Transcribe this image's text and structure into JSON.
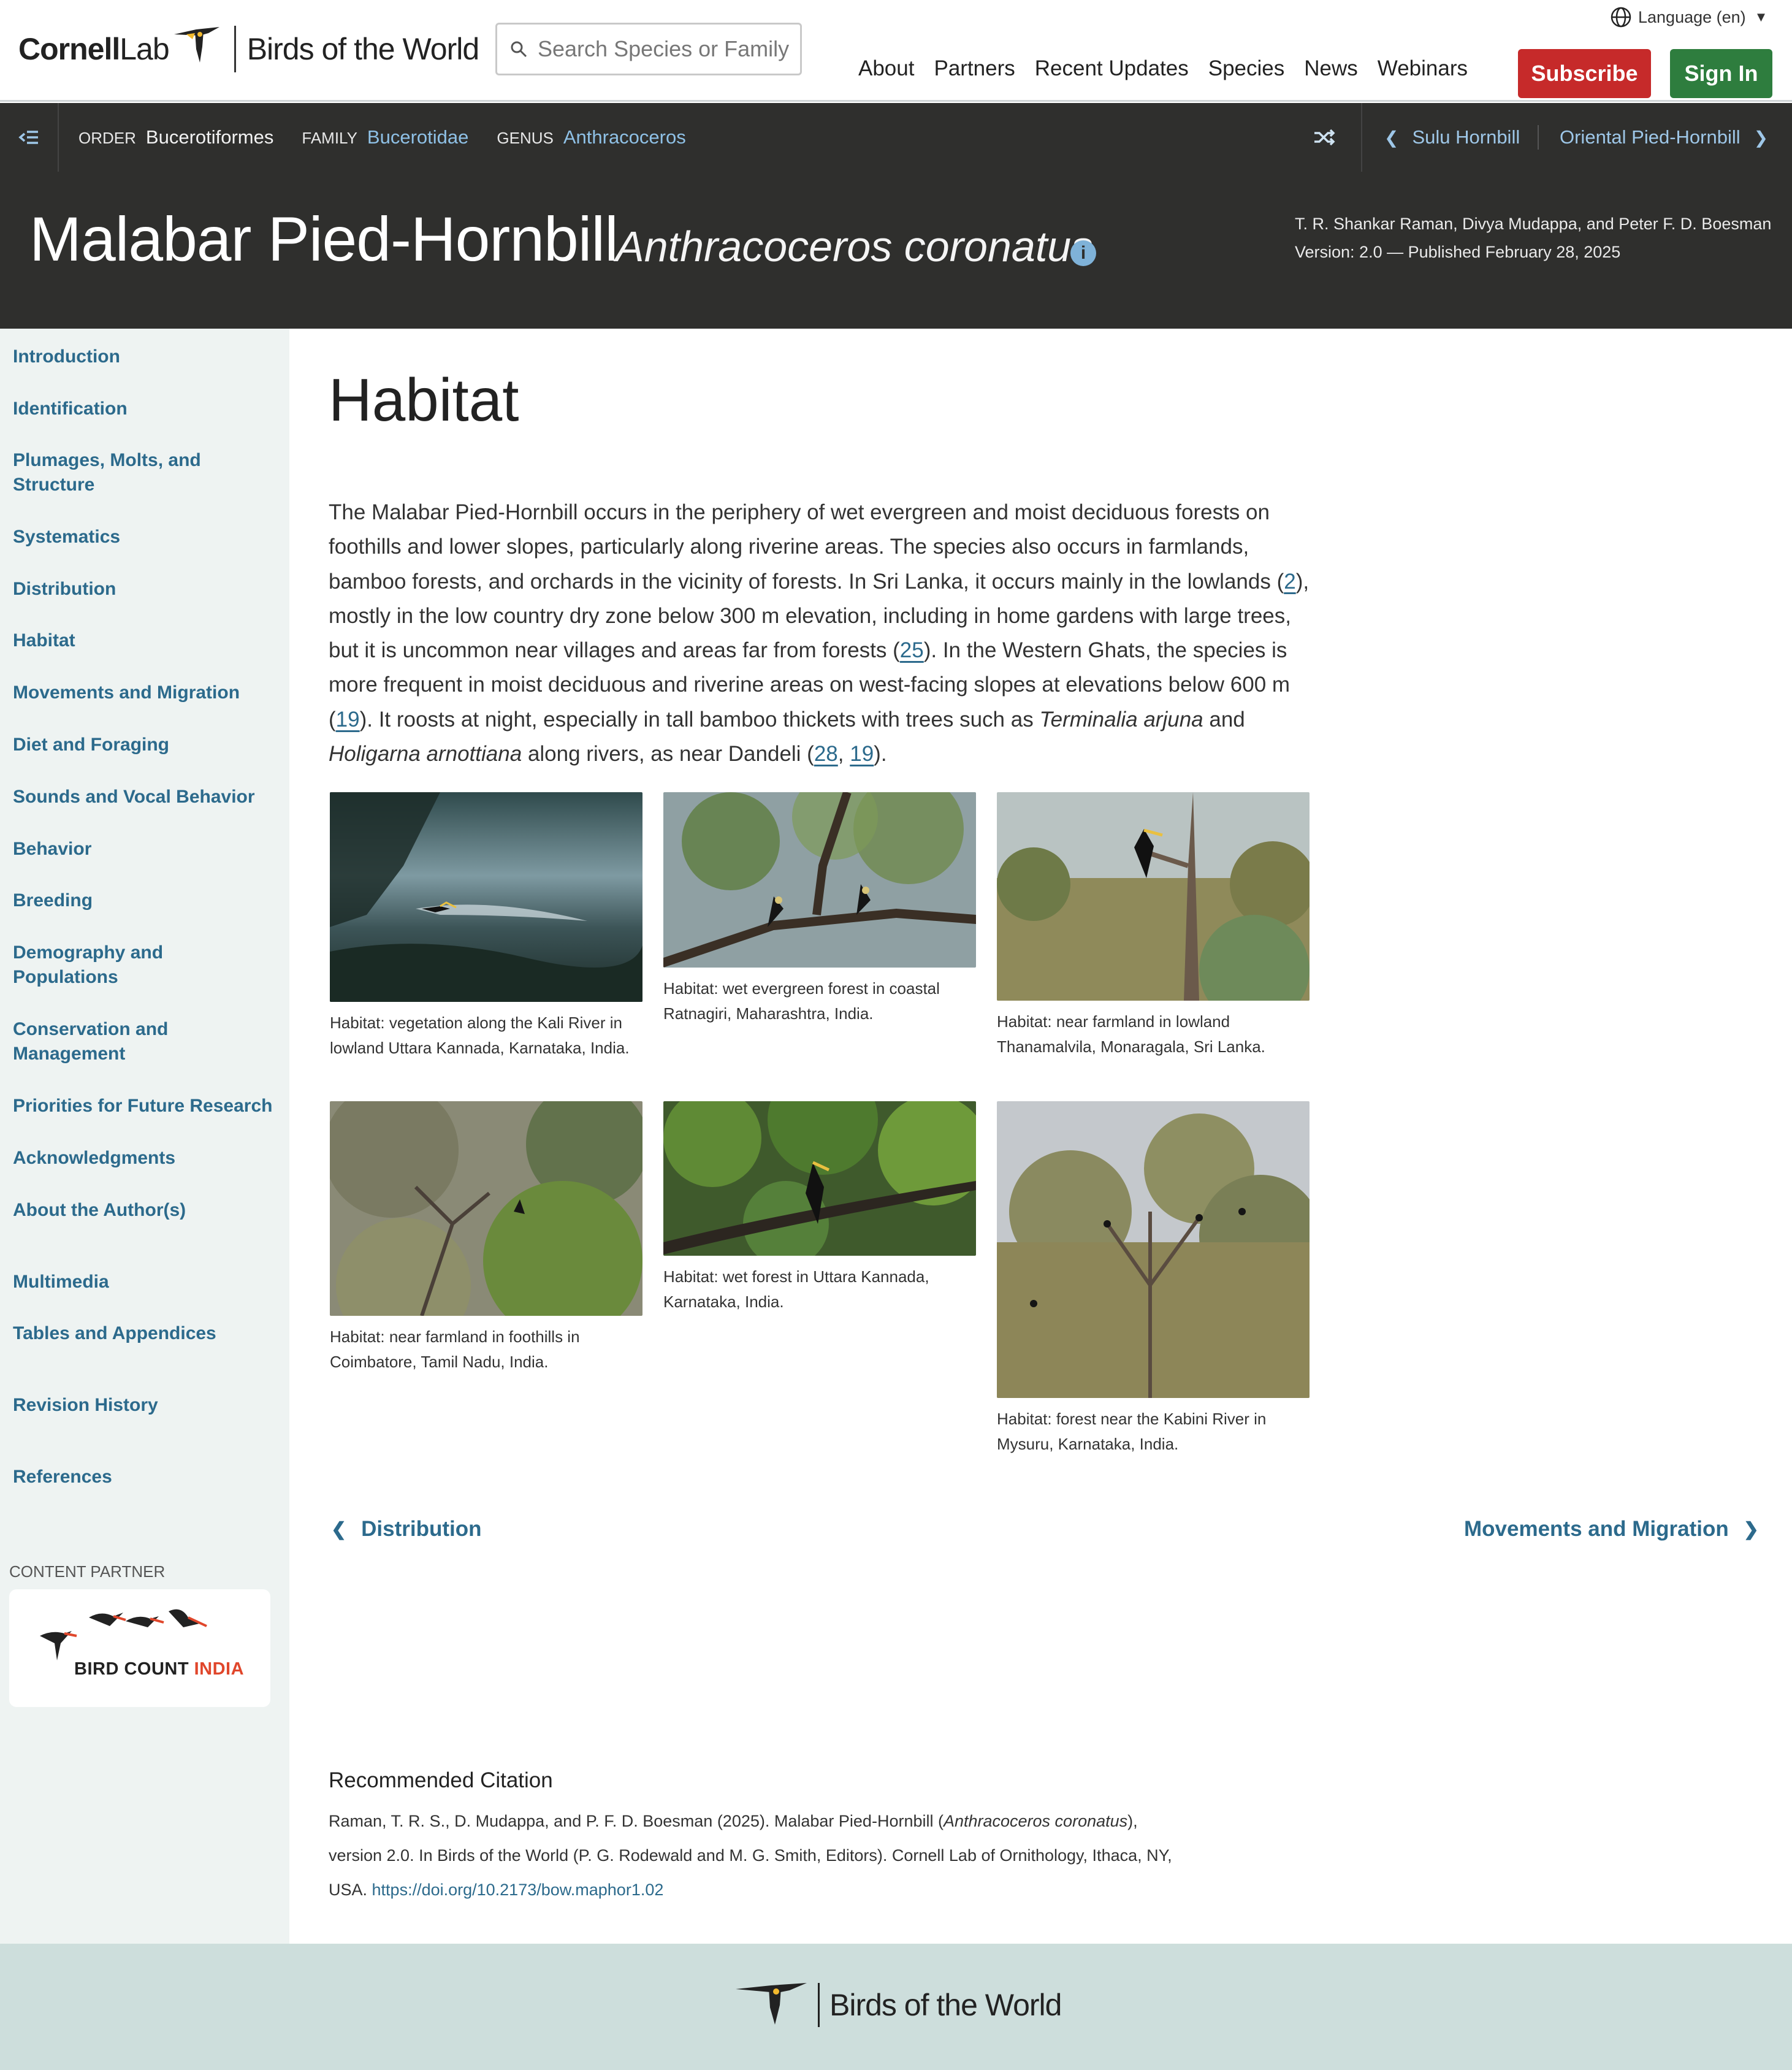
{
  "header": {
    "logo_lab": "CornellLab",
    "logo_lab_bold": "Cornell",
    "logo_lab_light": "Lab",
    "logo_title": "Birds of the World",
    "search_placeholder": "Search Species or Family",
    "language": "Language (en)",
    "nav": [
      "About",
      "Partners",
      "Recent Updates",
      "Species",
      "News",
      "Webinars"
    ],
    "subscribe": "Subscribe",
    "sign_in": "Sign In"
  },
  "taxonomy": {
    "order_label": "ORDER",
    "order": "Bucerotiformes",
    "family_label": "FAMILY",
    "family": "Bucerotidae",
    "genus_label": "GENUS",
    "genus": "Anthracoceros",
    "prev_species": "Sulu Hornbill",
    "next_species": "Oriental Pied-Hornbill"
  },
  "species": {
    "common_name": "Malabar Pied-Hornbill",
    "scientific_name": "Anthracoceros coronatus",
    "authors": "T. R. Shankar Raman, Divya Mudappa, and Peter F. D. Boesman",
    "version": "Version: 2.0 — Published February 28, 2025"
  },
  "sidebar": {
    "items": [
      "Introduction",
      "Identification",
      "Plumages, Molts, and",
      "Structure",
      "Systematics",
      "Distribution",
      "Habitat",
      "Movements and Migration",
      "Diet and Foraging",
      "Sounds and Vocal Behavior",
      "Behavior",
      "Breeding",
      "Demography and",
      "Populations",
      "Conservation and",
      "Management",
      "Priorities for Future Research",
      "Acknowledgments",
      "About the Author(s)",
      "Multimedia",
      "Tables and Appendices",
      "Revision History",
      "References"
    ],
    "content_partner_label": "CONTENT PARTNER",
    "partner_name_a": "BIRD COUNT ",
    "partner_name_b": "INDIA"
  },
  "article": {
    "heading": "Habitat",
    "p1": "The Malabar Pied-Hornbill occurs in the periphery of wet evergreen and moist deciduous forests on foothills and lower slopes, particularly along riverine areas. The species also occurs in farmlands, bamboo forests, and orchards in the vicinity of forests. In Sri Lanka, it occurs mainly in the lowlands (",
    "ref_2": "2",
    "p2": "), mostly in the low country dry zone below 300 m elevation, including in home gardens with large trees, but it is uncommon near villages and areas far from forests (",
    "ref_25": "25",
    "p3": "). In the Western Ghats, the species is more frequent in moist deciduous and riverine areas on west-facing slopes at elevations below 600 m (",
    "ref_19a": "19",
    "p4": "). It roosts at night, especially in tall bamboo thickets with trees such as ",
    "sp1": "Terminalia arjuna",
    "p5": " and ",
    "sp2": "Holigarna arnottiana",
    "p6": " along rivers, as near Dandeli (",
    "ref_28": "28",
    "comma": ", ",
    "ref_19b": "19",
    "p7": ")."
  },
  "figures": [
    {
      "caption": "Habitat: vegetation along the Kali River in lowland Uttara Kannada, Karnataka, India."
    },
    {
      "caption": "Habitat: wet evergreen forest in coastal Ratnagiri, Maharashtra, India."
    },
    {
      "caption": "Habitat: near farmland in lowland Thanamalvila, Monaragala, Sri Lanka."
    },
    {
      "caption": "Habitat: near farmland in foothills in Coimbatore, Tamil Nadu, India."
    },
    {
      "caption": "Habitat: wet forest in Uttara Kannada, Karnataka, India."
    },
    {
      "caption": "Habitat: forest near the Kabini River in Mysuru, Karnataka, India."
    }
  ],
  "page_nav": {
    "prev": "Distribution",
    "next": "Movements and Migration"
  },
  "citation": {
    "heading": "Recommended Citation",
    "text_a": "Raman, T. R. S., D. Mudappa, and P. F. D. Boesman (2025). Malabar Pied-Hornbill (",
    "text_sci": "Anthracoceros coronatus",
    "text_b": "), version 2.0. In Birds of the World (P. G. Rodewald and M. G. Smith, Editors). Cornell Lab of Ornithology, Ithaca, NY, USA. ",
    "doi": "https://doi.org/10.2173/bow.maphor1.02"
  },
  "footer": {
    "title": "Birds of the World"
  },
  "colors": {
    "accent_link": "#2c6a8c",
    "subscribe_red": "#c62a2a",
    "signin_green": "#2e7d3e",
    "dark_bar": "#2f2f2d",
    "sidebar_bg": "#eef3f2",
    "footer_bg": "#cddedc"
  },
  "icons": [
    "search-icon",
    "globe-icon",
    "caret-down-icon",
    "toc-toggle-icon",
    "shuffle-icon",
    "chevron-left-icon",
    "chevron-right-icon",
    "info-icon"
  ]
}
